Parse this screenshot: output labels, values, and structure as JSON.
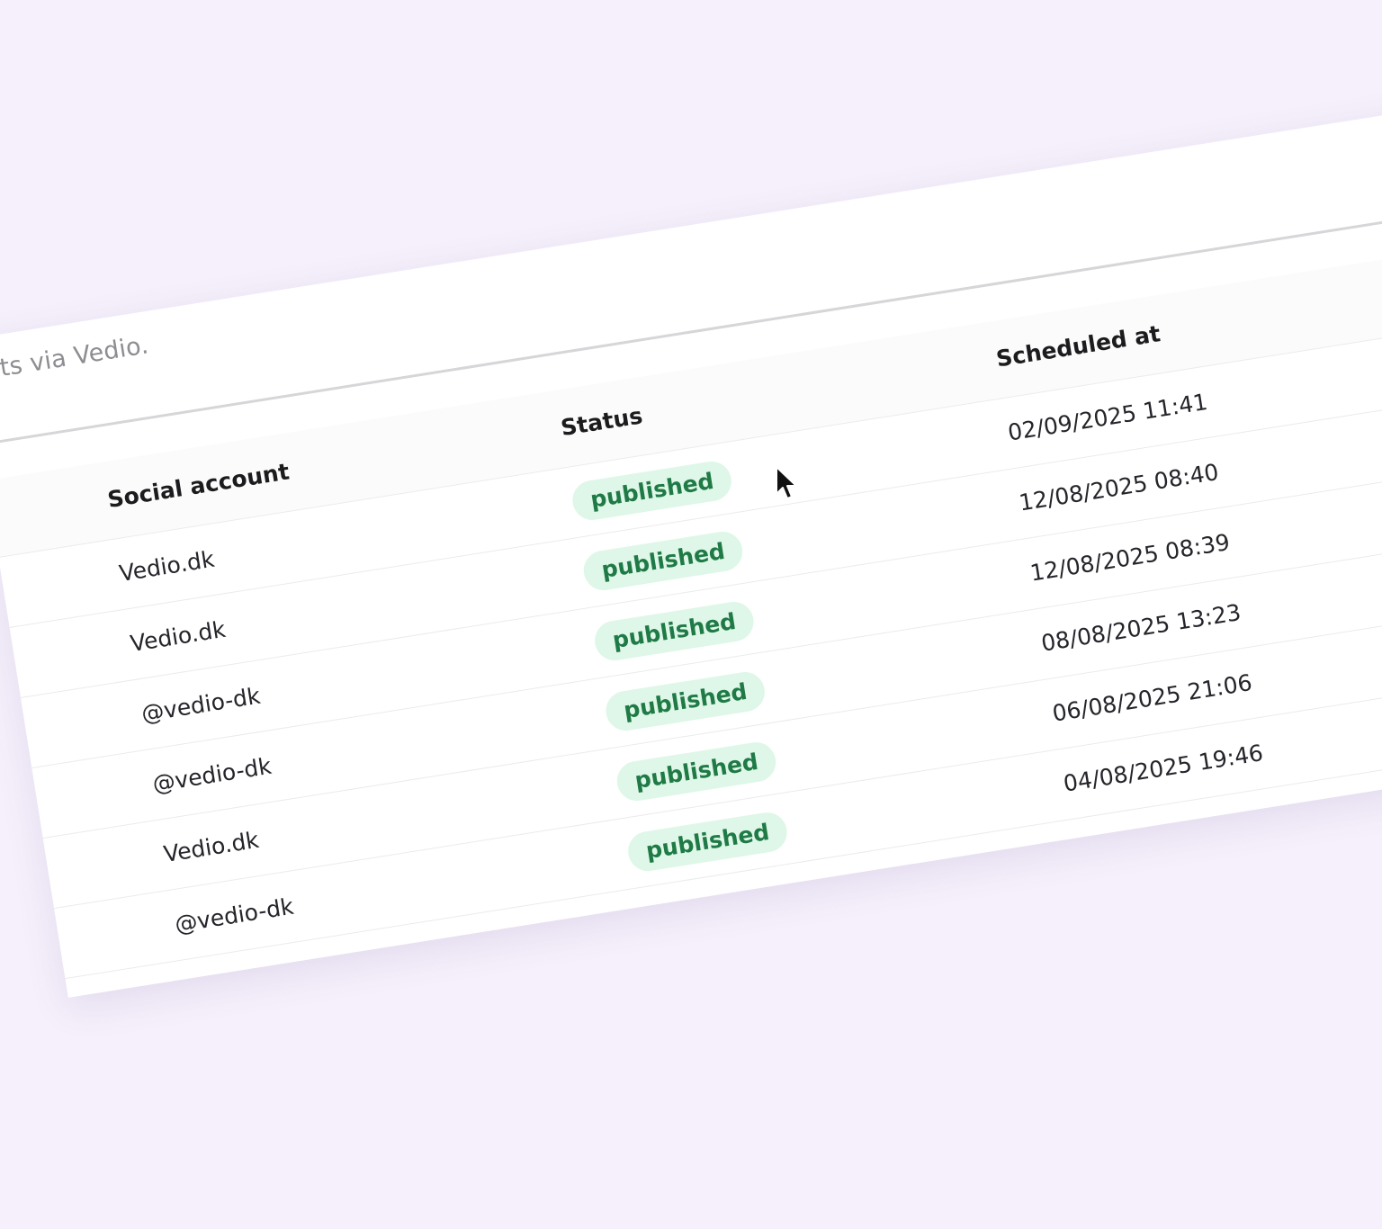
{
  "subtitle": "unts via Vedio.",
  "table": {
    "headers": {
      "social_account": "Social account",
      "status": "Status",
      "scheduled_at": "Scheduled at"
    },
    "rows": [
      {
        "account": "Vedio.dk",
        "status": "published",
        "scheduled": "02/09/2025 11:41"
      },
      {
        "account": "Vedio.dk",
        "status": "published",
        "scheduled": "12/08/2025 08:40"
      },
      {
        "account": "@vedio-dk",
        "status": "published",
        "scheduled": "12/08/2025 08:39"
      },
      {
        "account": "@vedio-dk",
        "status": "published",
        "scheduled": "08/08/2025 13:23"
      },
      {
        "account": "Vedio.dk",
        "status": "published",
        "scheduled": "06/08/2025 21:06"
      },
      {
        "account": "@vedio-dk",
        "status": "published",
        "scheduled": "04/08/2025 19:46"
      }
    ]
  },
  "colors": {
    "page_background": "#f5f0fb",
    "badge_background": "#def7e8",
    "badge_text": "#1f7a46"
  },
  "icons": {
    "cursor": "mouse-pointer-icon"
  }
}
